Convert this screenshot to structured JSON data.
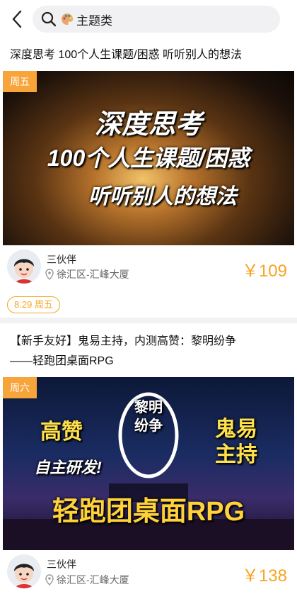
{
  "header": {
    "search_query": "主题类",
    "accent": "#f5a623"
  },
  "cards": [
    {
      "title": "深度思考 100个人生课题/困惑 听听别人的想法",
      "day_badge": "周五",
      "banner_lines": [
        "深度思考",
        "100个人生课题/困惑",
        "听听别人的想法"
      ],
      "host": "三伙伴",
      "address": "徐汇区-汇峰大厦",
      "price": "￥109",
      "date_chip": "8.29 周五"
    },
    {
      "title_line1": "【新手友好】鬼易主持，内测高赞：黎明纷争",
      "title_line2": "——轻跑团桌面RPG",
      "day_badge": "周六",
      "banner_texts": {
        "left_top": "高赞",
        "left_mid": "自主研发!",
        "center": "黎明纷争",
        "right": "鬼易主持",
        "bottom": "轻跑团桌面RPG"
      },
      "host": "三伙伴",
      "address": "徐汇区-汇峰大厦",
      "price": "￥138"
    }
  ]
}
